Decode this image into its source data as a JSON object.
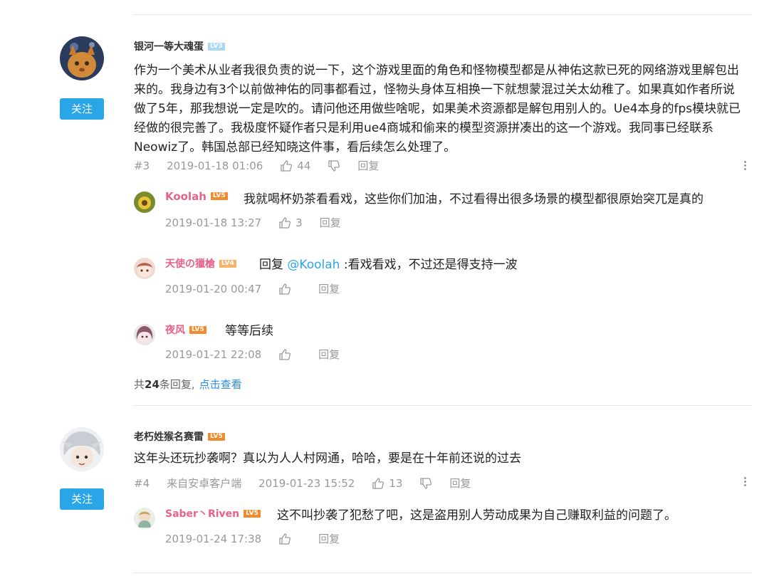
{
  "comments": [
    {
      "username": "银河一等大魂蛋",
      "level": "LV3",
      "follow_label": "关注",
      "text": "作为一个美术从业者我很负责的说一下，这个游戏里面的角色和怪物模型都是从神佑这款已死的网络游戏里解包出来的。我身边有3个以前做神佑的同事都看过，怪物头身体互相换一下就想蒙混过关太幼稚了。如果真如作者所说做了5年，那我想说一定是吹的。请问他还用做些啥呢，如果美术资源都是解包用别人的。Ue4本身的fps模块就已经做的很完善了。我极度怀疑作者只是利用ue4商城和偷来的模型资源拼凑出的这一个游戏。我同事已经联系Neowiz了。韩国总部已经知晓这件事，看后续怎么处理了。",
      "floor": "#3",
      "time": "2019-01-18 01:06",
      "likes": "44",
      "reply_label": "回复",
      "replies": [
        {
          "username": "Koolah",
          "level": "LV5",
          "text": "我就喝杯奶茶看看戏，这些你们加油，不过看得出很多场景的模型都很原始突兀是真的",
          "time": "2019-01-18 13:27",
          "likes": "3",
          "reply_label": "回复"
        },
        {
          "username": "天使の獵槍",
          "level": "LV4",
          "prefix": "回复 ",
          "mention": "@Koolah",
          "text": " :看戏看戏，不过还是得支持一波",
          "time": "2019-01-20 00:47",
          "likes": "",
          "reply_label": "回复"
        },
        {
          "username": "夜风",
          "level": "LV5",
          "text": "等等后续",
          "time": "2019-01-21 22:08",
          "likes": "",
          "reply_label": "回复"
        }
      ],
      "summary_prefix": "共",
      "summary_count": "24",
      "summary_suffix": "条回复,",
      "summary_link": "点击查看"
    },
    {
      "username": "老朽姓猴名赛雷",
      "level": "LV5",
      "follow_label": "关注",
      "text": "这年头还玩抄袭啊？真以为人人村网通，哈哈，要是在十年前还说的过去",
      "floor": "#4",
      "source": "来自安卓客户端",
      "time": "2019-01-23 15:52",
      "likes": "13",
      "reply_label": "回复",
      "replies": [
        {
          "username": "Saber丶Riven",
          "level": "LV5",
          "text": "这不叫抄袭了犯愁了吧，这是盗用别人劳动成果为自己赚取利益的问题了。",
          "time": "2019-01-24 17:38",
          "likes": "",
          "reply_label": "回复"
        }
      ]
    }
  ],
  "colors": {
    "accent": "#2aa6e8",
    "pink_name": "#e8628a",
    "meta": "#999999"
  }
}
